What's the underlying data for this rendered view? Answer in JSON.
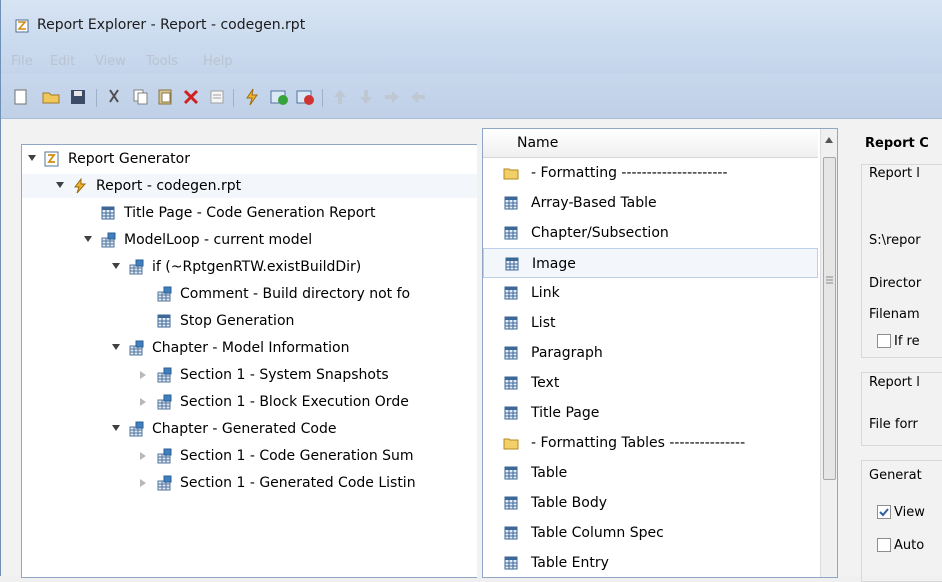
{
  "window": {
    "title": "Report Explorer - Report - codegen.rpt"
  },
  "menu": [
    "File",
    "Edit",
    "View",
    "Tools",
    "Help"
  ],
  "toolbar_icons": [
    "new-icon",
    "open-icon",
    "save-icon",
    "cut-icon",
    "copy-icon",
    "paste-icon",
    "delete-icon",
    "list-icon",
    "run-icon",
    "activate-icon",
    "deactivate-icon",
    "move-up-icon",
    "move-down-icon",
    "move-right-icon",
    "move-left-icon"
  ],
  "tree": [
    {
      "label": "Report Generator",
      "level": 0,
      "expand": "down",
      "icon": "report-generator-icon"
    },
    {
      "label": "Report - codegen.rpt",
      "level": 1,
      "expand": "down",
      "icon": "report-icon"
    },
    {
      "label": "Title Page - Code Generation Report",
      "level": 2,
      "expand": "none",
      "icon": "table-component-icon"
    },
    {
      "label": "ModelLoop - current model",
      "level": 2,
      "expand": "down",
      "icon": "loop-component-icon"
    },
    {
      "label": "if (~RptgenRTW.existBuildDir)",
      "level": 3,
      "expand": "down",
      "icon": "loop-component-icon"
    },
    {
      "label": "Comment - Build directory not fo",
      "level": 4,
      "expand": "none",
      "icon": "loop-component-icon"
    },
    {
      "label": "Stop Generation",
      "level": 4,
      "expand": "none",
      "icon": "table-component-icon"
    },
    {
      "label": "Chapter - Model Information",
      "level": 3,
      "expand": "down",
      "icon": "loop-component-icon"
    },
    {
      "label": "Section 1 - System Snapshots",
      "level": 4,
      "expand": "right",
      "icon": "loop-component-icon"
    },
    {
      "label": "Section 1 - Block Execution Orde",
      "level": 4,
      "expand": "right",
      "icon": "loop-component-icon"
    },
    {
      "label": "Chapter - Generated Code",
      "level": 3,
      "expand": "down",
      "icon": "loop-component-icon"
    },
    {
      "label": "Section 1 - Code Generation Sum",
      "level": 4,
      "expand": "right",
      "icon": "loop-component-icon"
    },
    {
      "label": "Section 1 - Generated Code Listin",
      "level": 4,
      "expand": "right",
      "icon": "loop-component-icon"
    }
  ],
  "list": {
    "header": "Name",
    "rows": [
      {
        "label": "- Formatting ---------------------",
        "type": "folder",
        "selected": false
      },
      {
        "label": "Array-Based Table",
        "type": "table",
        "selected": false
      },
      {
        "label": "Chapter/Subsection",
        "type": "table",
        "selected": false
      },
      {
        "label": "Image",
        "type": "table",
        "selected": true
      },
      {
        "label": "Link",
        "type": "table",
        "selected": false
      },
      {
        "label": "List",
        "type": "table",
        "selected": false
      },
      {
        "label": "Paragraph",
        "type": "table",
        "selected": false
      },
      {
        "label": "Text",
        "type": "table",
        "selected": false
      },
      {
        "label": "Title Page",
        "type": "table",
        "selected": false
      },
      {
        "label": "- Formatting Tables ---------------",
        "type": "folder",
        "selected": false
      },
      {
        "label": "Table",
        "type": "table",
        "selected": false
      },
      {
        "label": "Table Body",
        "type": "table",
        "selected": false
      },
      {
        "label": "Table Column Spec",
        "type": "table",
        "selected": false
      },
      {
        "label": "Table Entry",
        "type": "table",
        "selected": false
      }
    ]
  },
  "right": {
    "title": "Report C",
    "group1": "Report l",
    "path": "S:\\repor",
    "directory": "Director",
    "filename": "Filenam",
    "if_checkbox": "If re",
    "group2": "Report l",
    "file_format": "File forr",
    "group3": "Generat",
    "view_checkbox": "View",
    "auto_checkbox": "Auto"
  },
  "colors": {
    "title_bar": "#cfdff2",
    "selection": "#f3f7fc",
    "selection_border": "#bcd0ea"
  }
}
